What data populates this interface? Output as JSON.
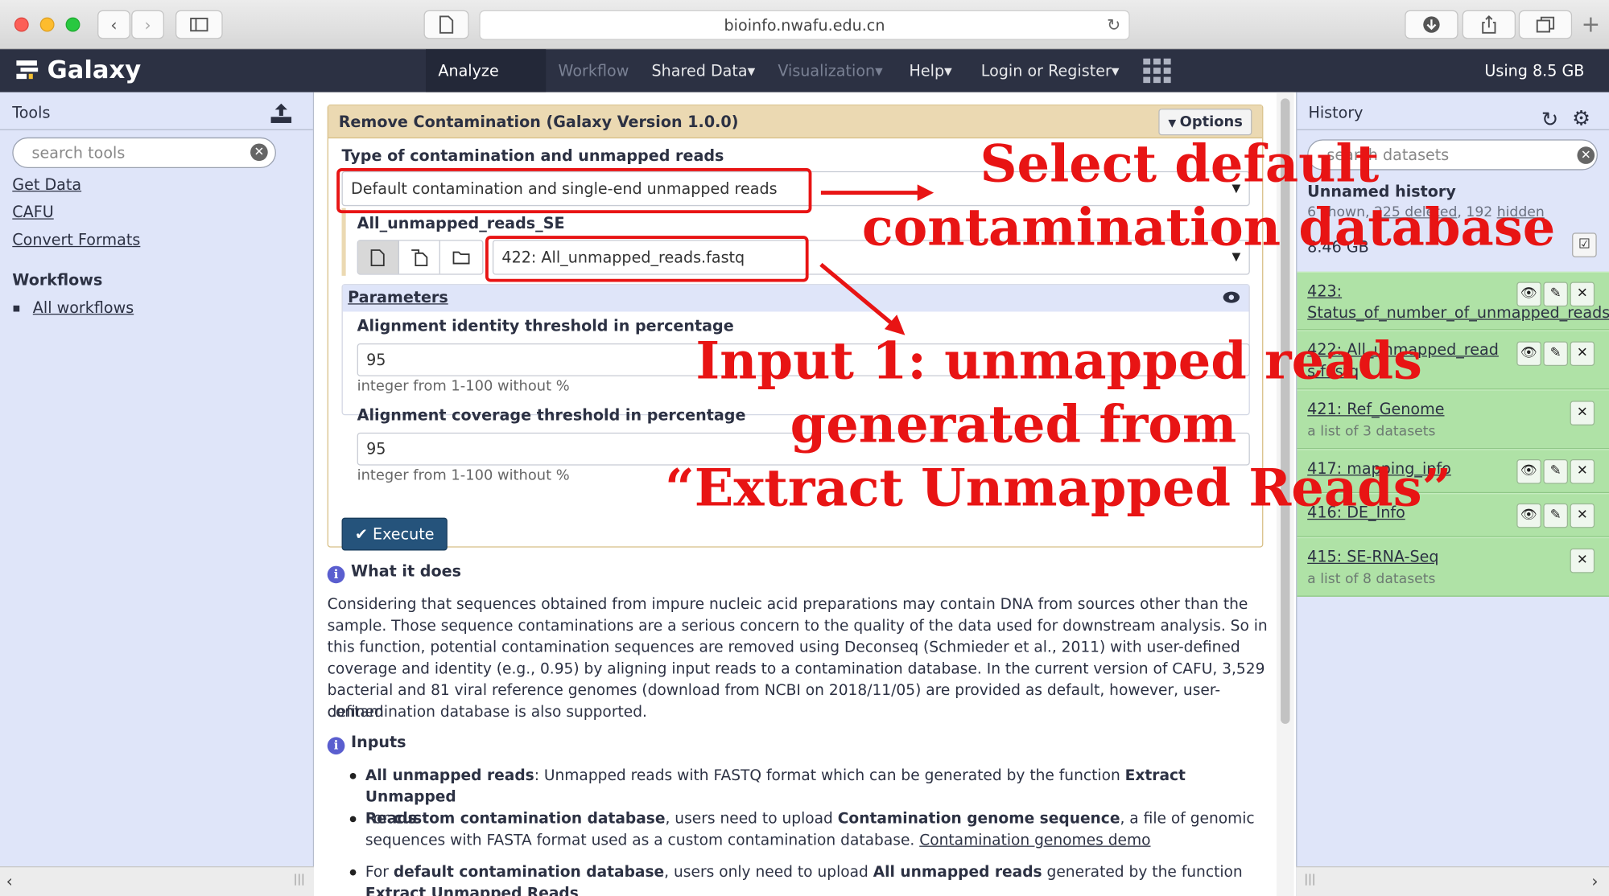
{
  "browser": {
    "url": "bioinfo.nwafu.edu.cn"
  },
  "masthead": {
    "brand": "Galaxy",
    "nav": [
      {
        "label": "Analyze Data",
        "caret": ""
      },
      {
        "label": "Workflow",
        "caret": ""
      },
      {
        "label": "Shared Data",
        "caret": "▾"
      },
      {
        "label": "Visualization",
        "caret": "▾"
      },
      {
        "label": "Help",
        "caret": "▾"
      },
      {
        "label": "Login or Register",
        "caret": "▾"
      }
    ],
    "usage": "Using 8.5 GB"
  },
  "tools": {
    "title": "Tools",
    "search_placeholder": "search tools",
    "links": [
      "Get Data",
      "CAFU",
      "Convert Formats"
    ],
    "workflows_title": "Workflows",
    "workflow_link": "All workflows"
  },
  "form": {
    "title": "Remove Contamination (Galaxy Version 1.0.0)",
    "options_label": "Options",
    "type_label": "Type of contamination and unmapped reads",
    "type_value": "Default contamination and single-end unmapped reads",
    "input_label": "All_unmapped_reads_SE",
    "input_value": "422: All_unmapped_reads.fastq",
    "params_label": "Parameters",
    "identity_label": "Alignment identity threshold in percentage",
    "identity_value": "95",
    "identity_help": "integer from 1-100 without %",
    "coverage_label": "Alignment coverage threshold in percentage",
    "coverage_value": "95",
    "coverage_help": "integer from 1-100 without %",
    "execute_label": "Execute"
  },
  "help": {
    "what_title": "What it does",
    "what_lines": [
      "Considering that sequences obtained from impure nucleic acid preparations may contain DNA from sources other than the",
      "sample. Those sequence contaminations are a serious concern to the quality of the data used for downstream analysis. So in",
      "this function, potential contamination sequences are removed using Deconseq (Schmieder et al., 2011) with user-defined",
      "coverage and identity (e.g., 0.95) by aligning input reads to a contamination database. In the current version of CAFU, 3,529",
      "bacterial and 81 viral reference genomes (download from NCBI on 2018/11/05) are provided as default, however, user-defined",
      "contamination database is also supported."
    ],
    "inputs_title": "Inputs",
    "b1_bold": "All unmapped reads",
    "b1_text": ": Unmapped reads with FASTQ format which can be generated by the function ",
    "b1_bold2": "Extract Unmapped",
    "b1_line2": "Reads",
    "b2_pre": "For ",
    "b2_bold": "custom contamination database",
    "b2_mid": ", users need to upload ",
    "b2_bold2": "Contamination genome sequence",
    "b2_text": ", a file of genomic",
    "b2_line2": "sequences with FASTA format used as a custom contamination database. ",
    "b2_link": "Contamination genomes demo",
    "b3_pre": "For ",
    "b3_bold": "default contamination database",
    "b3_mid": ", users only need to upload ",
    "b3_bold2": "All unmapped reads",
    "b3_text": " generated by the function",
    "b3_line2": "Extract Unmapped Reads"
  },
  "history": {
    "title": "History",
    "search_placeholder": "search datasets",
    "name": "Unnamed history",
    "stats_shown": "6 shown, ",
    "stats_deleted": "225 deleted",
    "stats_sep": ", 192 ",
    "stats_hidden": "hidden",
    "size": "8.46 GB",
    "items": [
      {
        "title": "423: Status_of_number_of_unmapped_reads",
        "sub": ""
      },
      {
        "title": "422: All_unmapped_reads.fastq",
        "sub": ""
      },
      {
        "title": "421: Ref_Genome",
        "sub": "a list of 3 datasets"
      },
      {
        "title": "417: mapping_info",
        "sub": ""
      },
      {
        "title": "416: DE_Info",
        "sub": ""
      },
      {
        "title": "415: SE-RNA-Seq",
        "sub": "a list of 8 datasets"
      }
    ]
  },
  "annotations": {
    "a1_l1": "Select default",
    "a1_l2": "contamination database",
    "a2_l1": "Input 1: unmapped reads",
    "a2_l2": "generated from",
    "a2_l3": "“Extract Unmapped Reads”"
  },
  "colors": {
    "masthead": "#2c3143",
    "panel": "#dfe5f9",
    "history_ok": "#afe2a6",
    "tool_header": "#ebd9b2",
    "execute": "#25537b",
    "annotation": "#e81414"
  }
}
